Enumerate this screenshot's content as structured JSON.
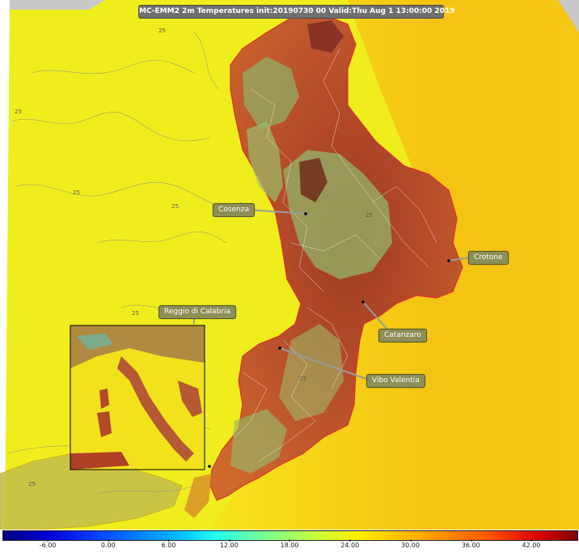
{
  "map": {
    "title": "MC-EMM2 2m Temperatures init:20190730 00  Valid:Thu Aug  1 13:00:00 2019",
    "cities": [
      {
        "name": "Cosenza"
      },
      {
        "name": "Crotone"
      },
      {
        "name": "Catanzaro"
      },
      {
        "name": "Vibo Valentia"
      },
      {
        "name": "Reggio di Calabria"
      }
    ],
    "contour_value_label": "25"
  },
  "colorbar": {
    "ticks": [
      "-6.00",
      "0.00",
      "6.00",
      "12.00",
      "18.00",
      "24.00",
      "30.00",
      "36.00",
      "42.00"
    ],
    "min": -10.5,
    "max": 46.5,
    "colors": {
      "sea": "#f3ee16",
      "lowland": "#b8452a",
      "upland": "#93b569",
      "highland": "#7a2a22"
    }
  }
}
